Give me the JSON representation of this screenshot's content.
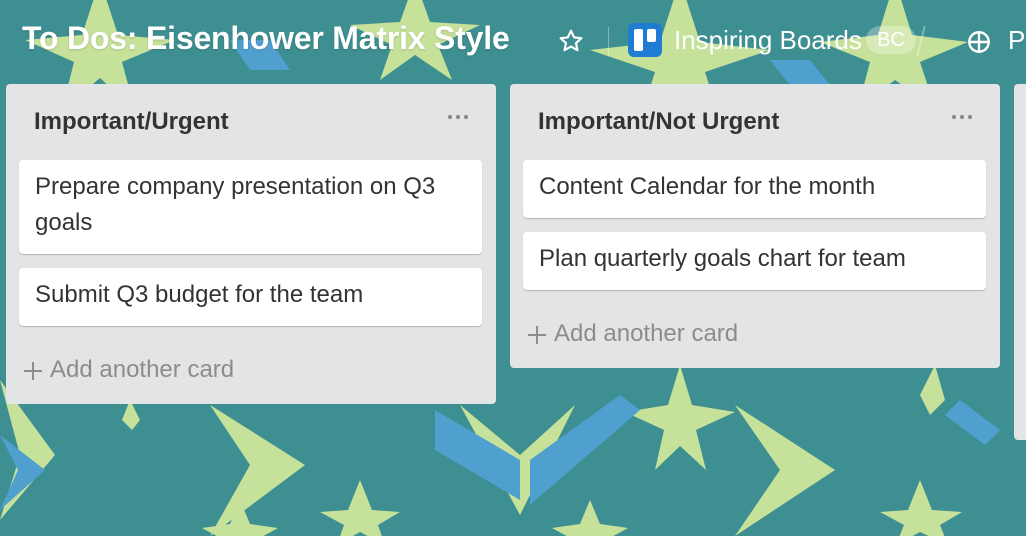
{
  "board": {
    "title": "To Dos: Eisenhower Matrix Style",
    "team_name": "Inspiring Boards",
    "team_badge": "BC",
    "visibility_label": "P"
  },
  "lists": [
    {
      "title": "Important/Urgent",
      "cards": [
        "Prepare company presentation on Q3 goals",
        "Submit Q3 budget for the team"
      ],
      "add_card_label": "Add another card"
    },
    {
      "title": "Important/Not Urgent",
      "cards": [
        "Content Calendar for the month",
        "Plan quarterly goals chart for team"
      ],
      "add_card_label": "Add another card"
    }
  ],
  "colors": {
    "background": "#3e8f92",
    "star_green": "#c6e19a",
    "star_blue": "#4f9fcf",
    "list_bg": "#e2e4e6",
    "trello_blue": "#1e7cd2"
  },
  "icons": {
    "star": "star-outline-icon",
    "trello": "trello-logo-icon",
    "globe": "globe-icon",
    "list_menu": "more-horizontal-icon",
    "add": "plus-icon"
  }
}
